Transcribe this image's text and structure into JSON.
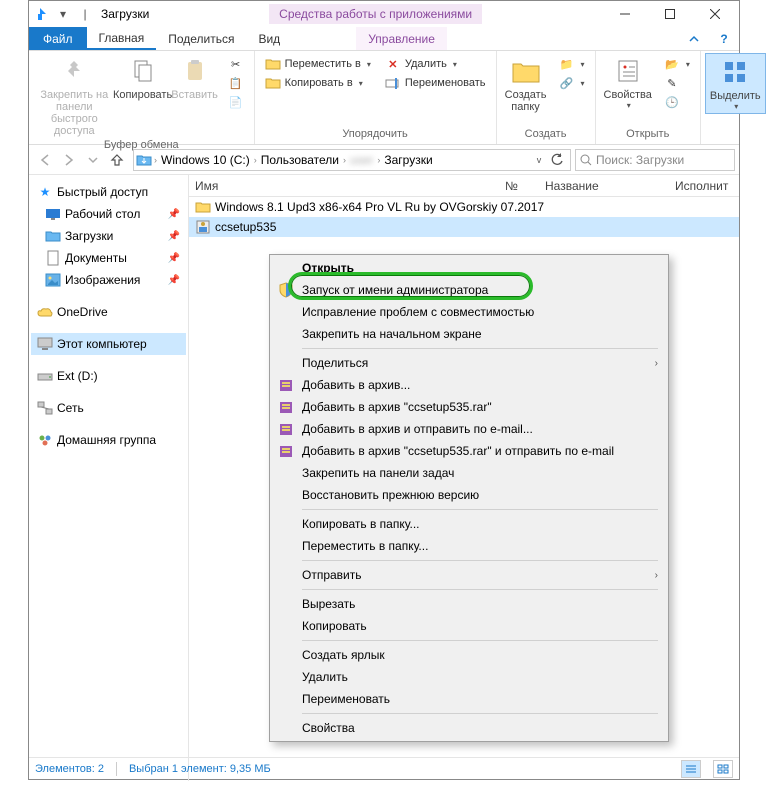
{
  "window": {
    "title": "Загрузки",
    "contextual_tab_group": "Средства работы с приложениями",
    "contextual_tab": "Управление"
  },
  "tabs": {
    "file": "Файл",
    "home": "Главная",
    "share": "Поделиться",
    "view": "Вид"
  },
  "ribbon": {
    "clipboard": {
      "pin": "Закрепить на панели\nбыстрого доступа",
      "copy": "Копировать",
      "paste": "Вставить",
      "label": "Буфер обмена"
    },
    "organize": {
      "moveto": "Переместить в",
      "copyto": "Копировать в",
      "delete": "Удалить",
      "rename": "Переименовать",
      "label": "Упорядочить"
    },
    "create": {
      "newfolder": "Создать\nпапку",
      "label": "Создать"
    },
    "open": {
      "properties": "Свойства",
      "label": "Открыть"
    },
    "select": {
      "select": "Выделить",
      "label": ""
    }
  },
  "breadcrumbs": {
    "b1": "Windows 10 (C:)",
    "b2": "Пользователи",
    "b3": "",
    "b4": "Загрузки"
  },
  "search": {
    "placeholder": "Поиск: Загрузки"
  },
  "nav": {
    "quick": "Быстрый доступ",
    "desktop": "Рабочий стол",
    "downloads": "Загрузки",
    "documents": "Документы",
    "pictures": "Изображения",
    "onedrive": "OneDrive",
    "thispc": "Этот компьютер",
    "extd": "Ext (D:)",
    "network": "Сеть",
    "homegroup": "Домашняя группа"
  },
  "columns": {
    "name": "Имя",
    "num": "№",
    "title": "Название",
    "artists": "Исполнит"
  },
  "files": {
    "f1": "Windows 8.1 Upd3 x86-x64 Pro VL Ru by OVGorskiy 07.2017",
    "f2": "ccsetup535"
  },
  "context_menu": {
    "open": "Открыть",
    "runas": "Запуск от имени администратора",
    "compat": "Исправление проблем с совместимостью",
    "pinstart": "Закрепить на начальном экране",
    "share": "Поделиться",
    "addarchive": "Добавить в архив...",
    "addrar": "Добавить в архив \"ccsetup535.rar\"",
    "addemail": "Добавить в архив и отправить по e-mail...",
    "addraremail": "Добавить в архив \"ccsetup535.rar\" и отправить по e-mail",
    "pintask": "Закрепить на панели задач",
    "restore": "Восстановить прежнюю версию",
    "copyto": "Копировать в папку...",
    "moveto": "Переместить в папку...",
    "sendto": "Отправить",
    "cut": "Вырезать",
    "copy": "Копировать",
    "shortcut": "Создать ярлык",
    "delete": "Удалить",
    "rename": "Переименовать",
    "props": "Свойства"
  },
  "status": {
    "count": "Элементов: 2",
    "selected": "Выбран 1 элемент: 9,35 МБ"
  }
}
